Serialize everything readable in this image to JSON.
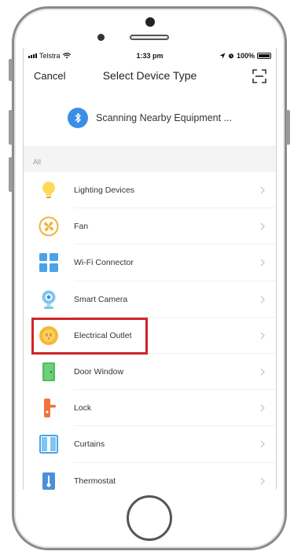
{
  "status_bar": {
    "carrier": "Telstra",
    "time": "1:33 pm",
    "battery": "100%",
    "battery_level": 1.0
  },
  "nav": {
    "cancel_label": "Cancel",
    "title": "Select Device Type",
    "scan_icon": "scan-frame-icon"
  },
  "scanning": {
    "icon": "bluetooth-icon",
    "text": "Scanning Nearby Equipment ...",
    "accent_color": "#3a8ee6"
  },
  "section": {
    "label": "All"
  },
  "devices": [
    {
      "label": "Lighting Devices",
      "icon": "lightbulb-icon"
    },
    {
      "label": "Fan",
      "icon": "fan-icon"
    },
    {
      "label": "Wi-Fi Connector",
      "icon": "wifi-connector-icon"
    },
    {
      "label": "Smart Camera",
      "icon": "camera-icon"
    },
    {
      "label": "Electrical Outlet",
      "icon": "outlet-icon"
    },
    {
      "label": "Door Window",
      "icon": "door-sensor-icon"
    },
    {
      "label": "Lock",
      "icon": "lock-icon"
    },
    {
      "label": "Curtains",
      "icon": "curtain-icon"
    },
    {
      "label": "Thermostat",
      "icon": "thermostat-icon"
    }
  ],
  "highlight": {
    "target": "Electrical Outlet",
    "color": "#d0242b"
  }
}
